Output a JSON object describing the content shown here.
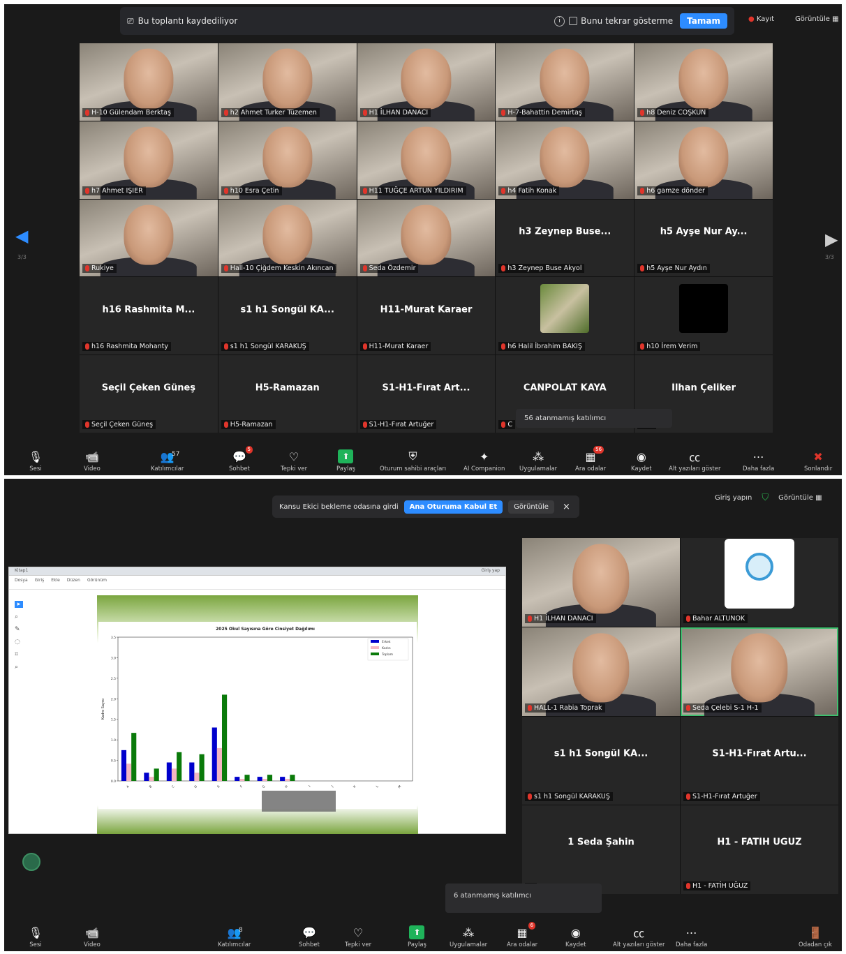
{
  "colors": {
    "accent": "#2d8cff",
    "danger": "#e0352b",
    "bg": "#1a1a1a",
    "tile": "#262626",
    "active_border": "#3fbf6f"
  },
  "top": {
    "recording_banner": {
      "text": "Bu toplantı kaydediliyor",
      "checkbox_label": "Bunu tekrar gösterme",
      "ok_label": "Tamam"
    },
    "rec_label": "Kayıt",
    "view_label": "Görüntüle",
    "page_left": "3/3",
    "page_right": "3/3",
    "tiles": [
      {
        "name": "H-10 Gülendam Berktaş",
        "video": true
      },
      {
        "name": "h2 Ahmet Turker Tüzemen",
        "video": true
      },
      {
        "name": "H1 İLHAN DANACI",
        "video": true
      },
      {
        "name": "H-7-Bahattin Demirtaş",
        "video": true
      },
      {
        "name": "h8 Deniz COŞKUN",
        "video": true
      },
      {
        "name": "h7 Ahmet IŞIER",
        "video": true
      },
      {
        "name": "h10 Esra Çetin",
        "video": true
      },
      {
        "name": "H11 TUĞÇE ARTUN YILDIRIM",
        "video": true
      },
      {
        "name": "h4 Fatih Konak",
        "video": true
      },
      {
        "name": "h6 gamze dönder",
        "video": true
      },
      {
        "name": "Rukiye",
        "video": true
      },
      {
        "name": "Hall-10 Çiğdem Keskin Akıncan",
        "video": true
      },
      {
        "name": "Seda Özdemir",
        "video": true
      },
      {
        "name": "h3 Zeynep Buse Akyol",
        "display": "h3 Zeynep Buse...",
        "video": false
      },
      {
        "name": "h5 Ayşe Nur Aydın",
        "display": "h5 Ayşe Nur Ay...",
        "video": false
      },
      {
        "name": "h16 Rashmita Mohanty",
        "display": "h16 Rashmita M...",
        "video": false
      },
      {
        "name": "s1 h1 Songül KARAKUŞ",
        "display": "s1 h1 Songül KA...",
        "video": false
      },
      {
        "name": "H11-Murat Karaer",
        "display": "H11-Murat Karaer",
        "video": false
      },
      {
        "name": "h6 Halil İbrahim BAKIŞ",
        "video": false,
        "avatar": "photo"
      },
      {
        "name": "h10 İrem Verim",
        "video": false,
        "avatar": "dark"
      },
      {
        "name": "Seçil Çeken Güneş",
        "display": "Seçil Çeken Güneş",
        "video": false
      },
      {
        "name": "H5-Ramazan",
        "display": "H5-Ramazan",
        "video": false
      },
      {
        "name": "S1-H1-Fırat Artuğer",
        "display": "S1-H1-Fırat Art...",
        "video": false
      },
      {
        "name": "C",
        "display": "CANPOLAT KAYA",
        "video": false
      },
      {
        "name": "ar",
        "display": "İlhan Çeliker",
        "video": false
      }
    ],
    "unassigned_popup": "56 atanmamış katılımcı",
    "toolbar": [
      {
        "icon": "mic-muted-icon",
        "label": "Sesi",
        "glyph": "🎙",
        "muted": true
      },
      {
        "icon": "video-off-icon",
        "label": "Video",
        "glyph": "📹",
        "muted": true
      },
      {
        "icon": "participants-icon",
        "label": "Katılımcılar",
        "glyph": "👥",
        "count": "57"
      },
      {
        "icon": "chat-icon",
        "label": "Sohbet",
        "glyph": "💬",
        "badge": "5"
      },
      {
        "icon": "react-icon",
        "label": "Tepki ver",
        "glyph": "♡"
      },
      {
        "icon": "share-icon",
        "label": "Paylaş",
        "glyph": "⬆",
        "green": true
      },
      {
        "icon": "shield-icon",
        "label": "Oturum sahibi araçları",
        "glyph": "⛨"
      },
      {
        "icon": "sparkle-icon",
        "label": "AI Companion",
        "glyph": "✦"
      },
      {
        "icon": "apps-icon",
        "label": "Uygulamalar",
        "glyph": "⁂"
      },
      {
        "icon": "breakout-icon",
        "label": "Ara odalar",
        "glyph": "▦",
        "badge": "56"
      },
      {
        "icon": "record-icon",
        "label": "Kaydet",
        "glyph": "◉"
      },
      {
        "icon": "cc-icon",
        "label": "Alt yazıları göster",
        "glyph": "㏄"
      },
      {
        "icon": "more-icon",
        "label": "Daha fazla",
        "glyph": "⋯"
      },
      {
        "icon": "end-icon",
        "label": "Sonlandır",
        "glyph": "✖",
        "red": true
      }
    ]
  },
  "bottom": {
    "waiting_banner": {
      "text": "Kansu Ekici bekleme odasına girdi",
      "admit_label": "Ana Oturuma Kabul Et",
      "view_label": "Görüntüle",
      "close": "×"
    },
    "signin_label": "Giriş yapın",
    "view_label": "Görüntüle",
    "tiles": [
      {
        "name": "H1 İLHAN DANACI",
        "video": true
      },
      {
        "name": "Bahar ALTUNOK",
        "video": false,
        "avatar": "logo"
      },
      {
        "name": "HALL-1 Rabia Toprak",
        "video": true
      },
      {
        "name": "Seda Çelebi S-1 H-1",
        "video": true,
        "active": true
      },
      {
        "name": "s1 h1 Songül KARAKUŞ",
        "display": "s1 h1 Songül KA...",
        "video": false
      },
      {
        "name": "S1-H1-Fırat Artuğer",
        "display": "S1-H1-Fırat Artu...",
        "video": false
      },
      {
        "name": "",
        "display": "1 Seda Şahin",
        "video": false
      },
      {
        "name": "H1 - FATİH UĞUZ",
        "display": "H1 - FATİH UĞUZ",
        "video": false
      }
    ],
    "unassigned_popup": "6 atanmamış katılımcı",
    "share_window": {
      "tab1": "Kitap1",
      "menu": [
        "Dosya",
        "Giriş",
        "Ekle",
        "Düzen",
        "Görünüm"
      ],
      "signin": "Giriş yap"
    },
    "toolbar": [
      {
        "icon": "mic-muted-icon",
        "label": "Sesi",
        "glyph": "🎙",
        "muted": true
      },
      {
        "icon": "video-off-icon",
        "label": "Video",
        "glyph": "📹",
        "muted": true
      },
      {
        "icon": "participants-icon",
        "label": "Katılımcılar",
        "glyph": "👥",
        "count": "8"
      },
      {
        "icon": "chat-icon",
        "label": "Sohbet",
        "glyph": "💬"
      },
      {
        "icon": "react-icon",
        "label": "Tepki ver",
        "glyph": "♡"
      },
      {
        "icon": "share-icon",
        "label": "Paylaş",
        "glyph": "⬆",
        "green": true
      },
      {
        "icon": "apps-icon",
        "label": "Uygulamalar",
        "glyph": "⁂"
      },
      {
        "icon": "breakout-icon",
        "label": "Ara odalar",
        "glyph": "▦",
        "badge": "6"
      },
      {
        "icon": "record-icon",
        "label": "Kaydet",
        "glyph": "◉"
      },
      {
        "icon": "cc-icon",
        "label": "Alt yazıları göster",
        "glyph": "㏄"
      },
      {
        "icon": "more-icon",
        "label": "Daha fazla",
        "glyph": "⋯"
      },
      {
        "icon": "leave-room-icon",
        "label": "Odadan çık",
        "glyph": "🚪",
        "red": true
      }
    ]
  },
  "chart_data": {
    "type": "bar",
    "title": "2025 Okul Sayısına Göre Cinsiyet Dağılımı",
    "ylabel": "Kadro Sayısı",
    "ylim": [
      0,
      3.5
    ],
    "yticks": [
      0,
      0.5,
      1.0,
      1.5,
      2.0,
      2.5,
      3.0,
      3.5
    ],
    "categories": [
      "A",
      "B",
      "C",
      "D",
      "E",
      "F",
      "G",
      "H",
      "I",
      "J",
      "K",
      "L",
      "M"
    ],
    "series": [
      {
        "name": "Erkek",
        "color": "#0000cc",
        "values": [
          0.75,
          0.2,
          0.45,
          0.45,
          1.3,
          0.1,
          0.1,
          0.1,
          0.0,
          0.0,
          0.0,
          0.0,
          0.0
        ]
      },
      {
        "name": "Kadın",
        "color": "#f4b6c2",
        "values": [
          0.42,
          0.1,
          0.3,
          0.2,
          0.8,
          0.05,
          0.05,
          0.05,
          0.0,
          0.0,
          0.0,
          0.0,
          0.0
        ]
      },
      {
        "name": "Toplam",
        "color": "#0a7a0a",
        "values": [
          1.17,
          0.3,
          0.7,
          0.65,
          2.1,
          0.15,
          0.15,
          0.15,
          0.0,
          0.0,
          0.0,
          0.0,
          0.0
        ]
      }
    ],
    "legend_position": "top-right"
  }
}
